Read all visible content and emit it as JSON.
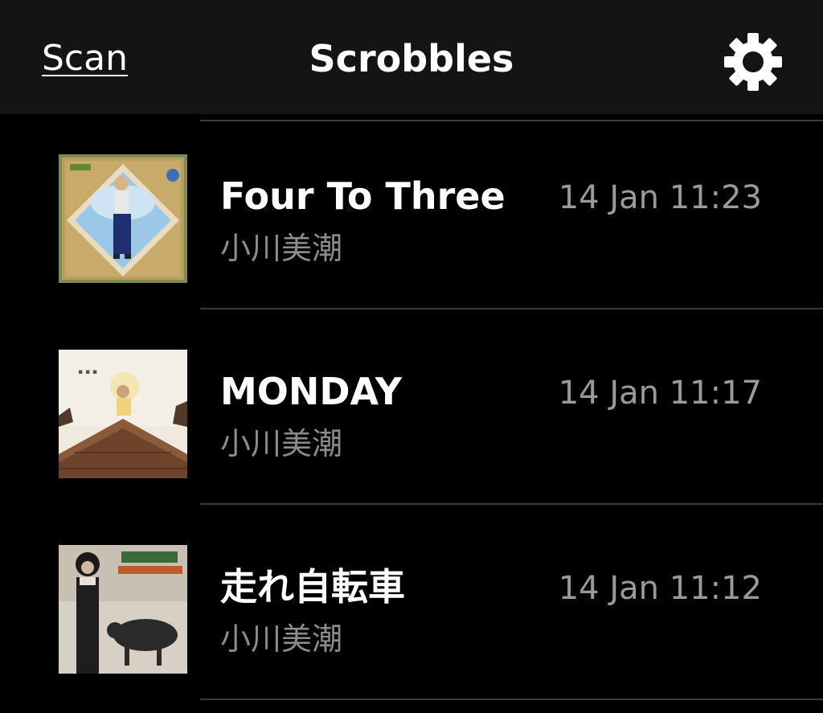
{
  "navbar": {
    "left_label": "Scan",
    "title": "Scrobbles",
    "right_icon": "gear-icon"
  },
  "scrobbles": [
    {
      "track": "Four To Three",
      "artist": "小川美潮",
      "time": "14 Jan 11:23",
      "art_icon": "album-art-girl-in-diamond-frame"
    },
    {
      "track": "MONDAY",
      "artist": "小川美潮",
      "time": "14 Jan 11:17",
      "art_icon": "album-art-rooftop-umbrella"
    },
    {
      "track": "走れ自転車",
      "artist": "小川美潮",
      "time": "14 Jan 11:12",
      "art_icon": "album-art-woman-with-bull"
    }
  ],
  "colors": {
    "background": "#000000",
    "navbar_bg": "#141414",
    "primary_text": "#ffffff",
    "secondary_text": "#8c8c8c",
    "separator": "#3a3a3a"
  }
}
